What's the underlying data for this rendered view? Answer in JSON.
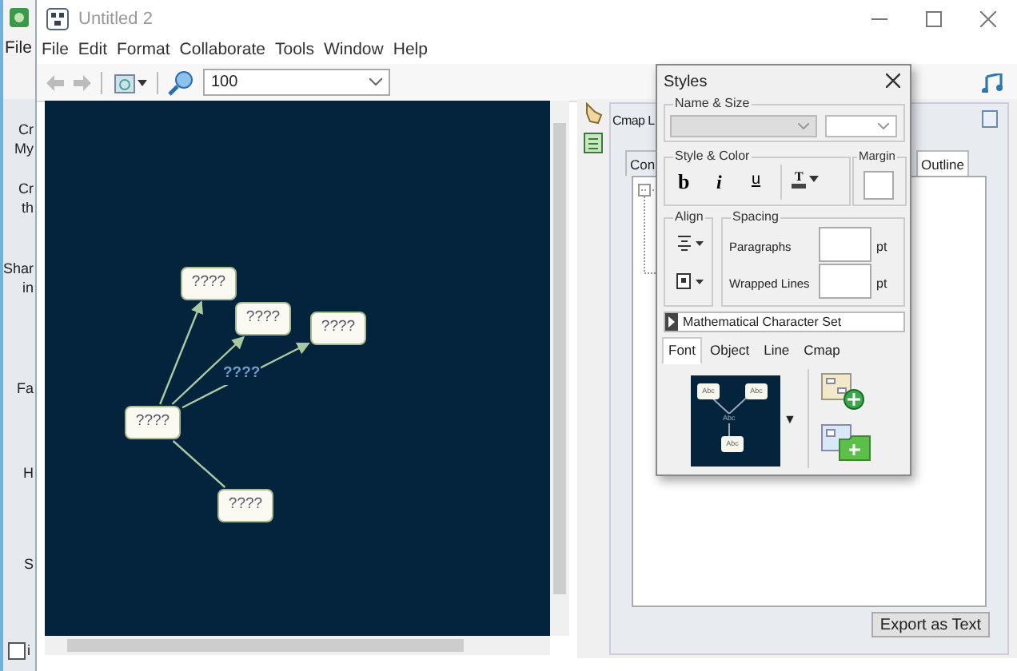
{
  "back_window": {
    "menu": [
      "File"
    ],
    "sidebar_items": [
      {
        "lines": [
          "Cr",
          "My"
        ]
      },
      {
        "lines": [
          "Cr",
          "th"
        ]
      },
      {
        "lines": [
          "Shar",
          "in"
        ]
      },
      {
        "lines": [
          "Fa"
        ]
      },
      {
        "lines": [
          "H"
        ]
      },
      {
        "lines": [
          "S"
        ]
      }
    ],
    "checkbox": {
      "label": "i",
      "checked": false
    }
  },
  "window": {
    "title": "Untitled 2"
  },
  "menu": [
    "File",
    "Edit",
    "Format",
    "Collaborate",
    "Tools",
    "Window",
    "Help"
  ],
  "toolbar": {
    "zoom": "100"
  },
  "canvas": {
    "nodes": [
      {
        "label": "????"
      },
      {
        "label": "????"
      },
      {
        "label": "????"
      },
      {
        "label": "????"
      },
      {
        "label": "????"
      }
    ],
    "links": [
      {
        "arrow": true
      },
      {
        "arrow": true
      },
      {
        "arrow": true,
        "label": "????"
      },
      {
        "arrow": false
      }
    ]
  },
  "cmap_panel": {
    "title": "Cmap L",
    "tabs": [
      {
        "label": "Con",
        "selected": false
      },
      {
        "label": "Outline",
        "selected": true
      }
    ],
    "button": "Export as Text"
  },
  "styles_dialog": {
    "title": "Styles",
    "name_size": "Name & Size",
    "style_color": "Style & Color",
    "bold": "b",
    "italic": "i",
    "underline": "u",
    "text_color": "T",
    "margin": "Margin",
    "align": "Align",
    "spacing": "Spacing",
    "spacing_rows": [
      {
        "label": "Paragraphs",
        "unit": "pt"
      },
      {
        "label": "Wrapped Lines",
        "unit": "pt"
      }
    ],
    "charset": "Mathematical Character Set",
    "tabs": [
      {
        "label": "Font",
        "selected": true
      },
      {
        "label": "Object",
        "selected": false
      },
      {
        "label": "Line",
        "selected": false
      },
      {
        "label": "Cmap",
        "selected": false
      }
    ],
    "preview_nodes": [
      "Abc",
      "Abc",
      "Abc"
    ],
    "preview_link": "Abc",
    "preview_caret": "▼"
  }
}
